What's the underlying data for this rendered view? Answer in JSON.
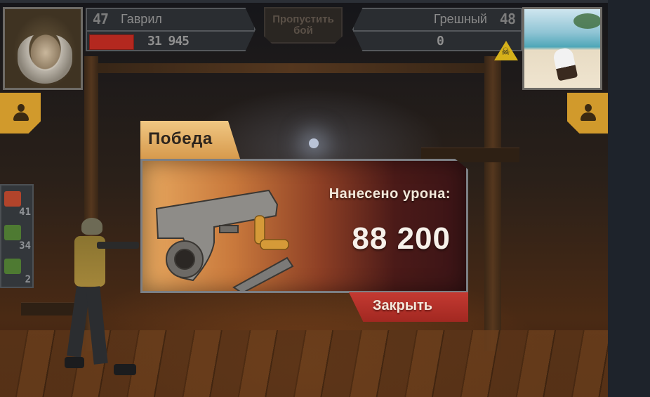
{
  "player": {
    "level": "47",
    "name": "Гаврил",
    "stat": "31 945"
  },
  "opponent": {
    "level": "48",
    "name": "Грешный",
    "stat": "0"
  },
  "skip_button": {
    "label": "Пропустить бой"
  },
  "items": [
    {
      "icon": "medkit-red-icon",
      "count": "41",
      "color": "#b2442b"
    },
    {
      "icon": "medkit-green-icon",
      "count": "34",
      "color": "#4e7a32"
    },
    {
      "icon": "medkit-green-icon",
      "count": "2",
      "color": "#4e7a32"
    }
  ],
  "victory": {
    "title": "Победа",
    "damage_label": "Нанесено урона:",
    "damage_value": "88 200",
    "close_label": "Закрыть"
  },
  "colors": {
    "accent": "#d19a2c",
    "hp": "#b3281f",
    "close": "#b8312a"
  }
}
